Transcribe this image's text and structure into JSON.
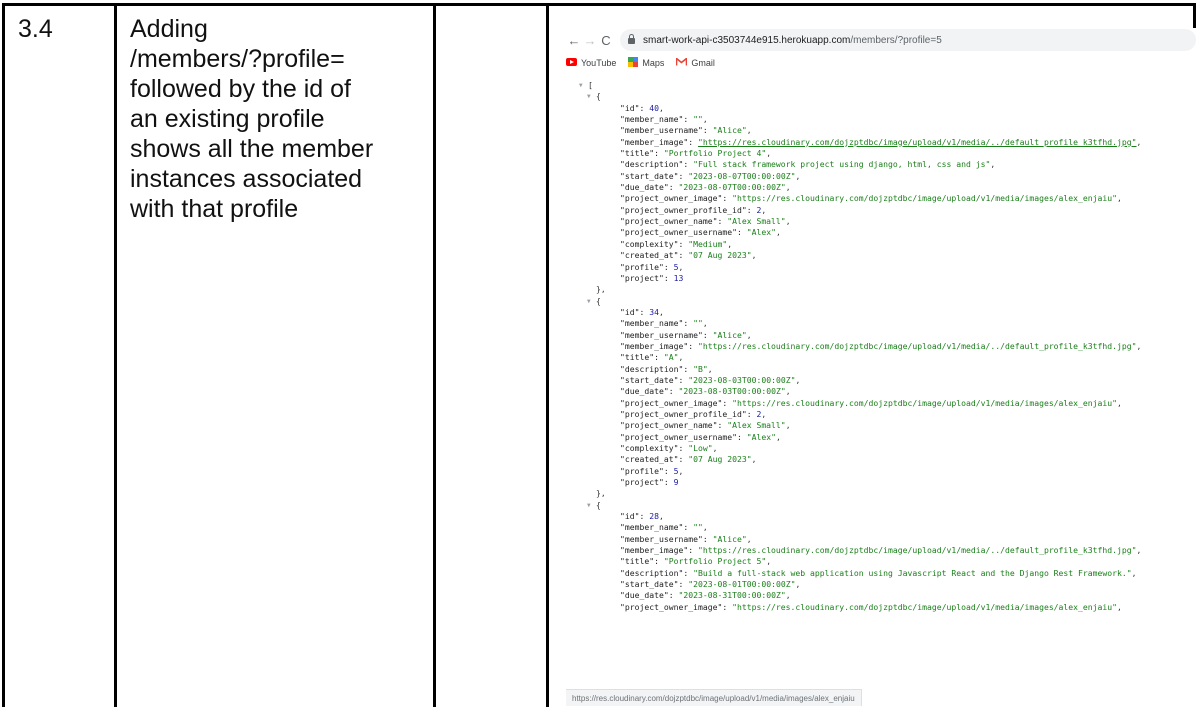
{
  "row": {
    "number": "3.4",
    "description_lines": [
      "Adding",
      "/members/?profile=",
      "followed by the id of",
      "an existing profile",
      "shows all the member",
      "instances associated",
      "with that profile"
    ]
  },
  "browser": {
    "nav": {
      "back_icon": "arrow-left-icon",
      "forward_icon": "arrow-right-icon",
      "reload_icon": "reload-icon"
    },
    "url": {
      "host": "smart-work-api-c3503744e915.herokuapp.com",
      "path": "/members/?profile=5"
    },
    "bookmarks": [
      {
        "label": "YouTube",
        "icon": "youtube-icon"
      },
      {
        "label": "Maps",
        "icon": "maps-icon"
      },
      {
        "label": "Gmail",
        "icon": "gmail-icon"
      }
    ],
    "status_url": "https://res.cloudinary.com/dojzptdbc/image/upload/v1/media/images/alex_enjaiu"
  },
  "json_lines": [
    {
      "indent": 0,
      "t": "[",
      "tri": true
    },
    {
      "indent": 1,
      "t": "{",
      "tri": true
    },
    {
      "indent": 2,
      "k": "id",
      "v": "40",
      "vt": "n",
      "c": true
    },
    {
      "indent": 2,
      "k": "member_name",
      "v": "\"\"",
      "vt": "s",
      "c": true
    },
    {
      "indent": 2,
      "k": "member_username",
      "v": "\"Alice\"",
      "vt": "s",
      "c": true
    },
    {
      "indent": 2,
      "k": "member_image",
      "v": "\"https://res.cloudinary.com/dojzptdbc/image/upload/v1/media/../default_profile_k3tfhd.jpg\"",
      "vt": "u",
      "c": true
    },
    {
      "indent": 2,
      "k": "title",
      "v": "\"Portfolio Project 4\"",
      "vt": "s",
      "c": true
    },
    {
      "indent": 2,
      "k": "description",
      "v": "\"Full stack framework project using django, html, css and js\"",
      "vt": "s",
      "c": true
    },
    {
      "indent": 2,
      "k": "start_date",
      "v": "\"2023-08-07T00:00:00Z\"",
      "vt": "s",
      "c": true
    },
    {
      "indent": 2,
      "k": "due_date",
      "v": "\"2023-08-07T00:00:00Z\"",
      "vt": "s",
      "c": true
    },
    {
      "indent": 2,
      "k": "project_owner_image",
      "v": "\"https://res.cloudinary.com/dojzptdbc/image/upload/v1/media/images/alex_enjaiu\"",
      "vt": "s",
      "c": true
    },
    {
      "indent": 2,
      "k": "project_owner_profile_id",
      "v": "2",
      "vt": "n",
      "c": true
    },
    {
      "indent": 2,
      "k": "project_owner_name",
      "v": "\"Alex Small\"",
      "vt": "s",
      "c": true
    },
    {
      "indent": 2,
      "k": "project_owner_username",
      "v": "\"Alex\"",
      "vt": "s",
      "c": true
    },
    {
      "indent": 2,
      "k": "complexity",
      "v": "\"Medium\"",
      "vt": "s",
      "c": true
    },
    {
      "indent": 2,
      "k": "created_at",
      "v": "\"07 Aug 2023\"",
      "vt": "s",
      "c": true
    },
    {
      "indent": 2,
      "k": "profile",
      "v": "5",
      "vt": "n",
      "c": true
    },
    {
      "indent": 2,
      "k": "project",
      "v": "13",
      "vt": "n",
      "c": false
    },
    {
      "indent": 1,
      "t": "},"
    },
    {
      "indent": 1,
      "t": "{",
      "tri": true
    },
    {
      "indent": 2,
      "k": "id",
      "v": "34",
      "vt": "n",
      "c": true
    },
    {
      "indent": 2,
      "k": "member_name",
      "v": "\"\"",
      "vt": "s",
      "c": true
    },
    {
      "indent": 2,
      "k": "member_username",
      "v": "\"Alice\"",
      "vt": "s",
      "c": true
    },
    {
      "indent": 2,
      "k": "member_image",
      "v": "\"https://res.cloudinary.com/dojzptdbc/image/upload/v1/media/../default_profile_k3tfhd.jpg\"",
      "vt": "s",
      "c": true
    },
    {
      "indent": 2,
      "k": "title",
      "v": "\"A\"",
      "vt": "s",
      "c": true
    },
    {
      "indent": 2,
      "k": "description",
      "v": "\"B\"",
      "vt": "s",
      "c": true
    },
    {
      "indent": 2,
      "k": "start_date",
      "v": "\"2023-08-03T00:00:00Z\"",
      "vt": "s",
      "c": true
    },
    {
      "indent": 2,
      "k": "due_date",
      "v": "\"2023-08-03T00:00:00Z\"",
      "vt": "s",
      "c": true
    },
    {
      "indent": 2,
      "k": "project_owner_image",
      "v": "\"https://res.cloudinary.com/dojzptdbc/image/upload/v1/media/images/alex_enjaiu\"",
      "vt": "s",
      "c": true
    },
    {
      "indent": 2,
      "k": "project_owner_profile_id",
      "v": "2",
      "vt": "n",
      "c": true
    },
    {
      "indent": 2,
      "k": "project_owner_name",
      "v": "\"Alex Small\"",
      "vt": "s",
      "c": true
    },
    {
      "indent": 2,
      "k": "project_owner_username",
      "v": "\"Alex\"",
      "vt": "s",
      "c": true
    },
    {
      "indent": 2,
      "k": "complexity",
      "v": "\"Low\"",
      "vt": "s",
      "c": true
    },
    {
      "indent": 2,
      "k": "created_at",
      "v": "\"07 Aug 2023\"",
      "vt": "s",
      "c": true
    },
    {
      "indent": 2,
      "k": "profile",
      "v": "5",
      "vt": "n",
      "c": true
    },
    {
      "indent": 2,
      "k": "project",
      "v": "9",
      "vt": "n",
      "c": false
    },
    {
      "indent": 1,
      "t": "},"
    },
    {
      "indent": 1,
      "t": "{",
      "tri": true
    },
    {
      "indent": 2,
      "k": "id",
      "v": "28",
      "vt": "n",
      "c": true
    },
    {
      "indent": 2,
      "k": "member_name",
      "v": "\"\"",
      "vt": "s",
      "c": true
    },
    {
      "indent": 2,
      "k": "member_username",
      "v": "\"Alice\"",
      "vt": "s",
      "c": true
    },
    {
      "indent": 2,
      "k": "member_image",
      "v": "\"https://res.cloudinary.com/dojzptdbc/image/upload/v1/media/../default_profile_k3tfhd.jpg\"",
      "vt": "s",
      "c": true
    },
    {
      "indent": 2,
      "k": "title",
      "v": "\"Portfolio Project 5\"",
      "vt": "s",
      "c": true
    },
    {
      "indent": 2,
      "k": "description",
      "v": "\"Build a full-stack web application using Javascript React and the Django Rest Framework.\"",
      "vt": "s",
      "c": true
    },
    {
      "indent": 2,
      "k": "start_date",
      "v": "\"2023-08-01T00:00:00Z\"",
      "vt": "s",
      "c": true
    },
    {
      "indent": 2,
      "k": "due_date",
      "v": "\"2023-08-31T00:00:00Z\"",
      "vt": "s",
      "c": true
    },
    {
      "indent": 2,
      "k": "project_owner_image",
      "v": "\"https://res.cloudinary.com/dojzptdbc/image/upload/v1/media/images/alex_enjaiu\"",
      "vt": "s",
      "c": true
    }
  ]
}
